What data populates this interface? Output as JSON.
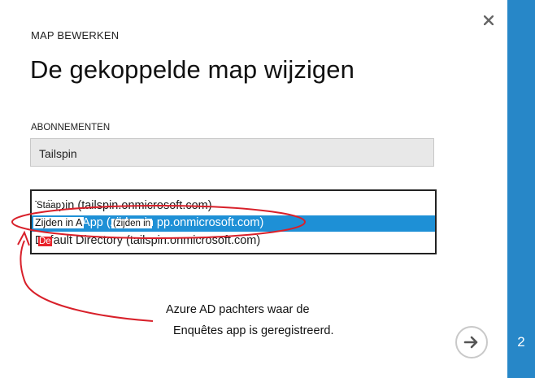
{
  "dialog": {
    "kicker": "MAP BEWERKEN",
    "title": "De gekoppelde map wijzigen"
  },
  "subscriptions": {
    "label": "ABONNEMENTEN",
    "value": "Tailspin"
  },
  "directories": {
    "items": [
      {
        "text": "Tailspin (tailspin.onmicrosoft.com)",
        "overlay": "Staap",
        "selected": false
      },
      {
        "text": "Zijden in App (zijden in pp.onmicrosoft.com)",
        "overlay_a": "Zijden in A",
        "overlay_b": "(zijden in",
        "selected": true
      },
      {
        "text": "Default Directory (tailspin.onmicrosoft.com)",
        "overlay": "De",
        "selected": false
      }
    ]
  },
  "annotation": {
    "line1": "Azure AD pachters waar de",
    "line2": "Enquêtes app is geregistreerd.",
    "color": "#d8202a"
  },
  "rail": {
    "step": "2",
    "color": "#2787c8"
  },
  "icons": {
    "close": "close-icon",
    "next": "arrow-right-icon"
  }
}
